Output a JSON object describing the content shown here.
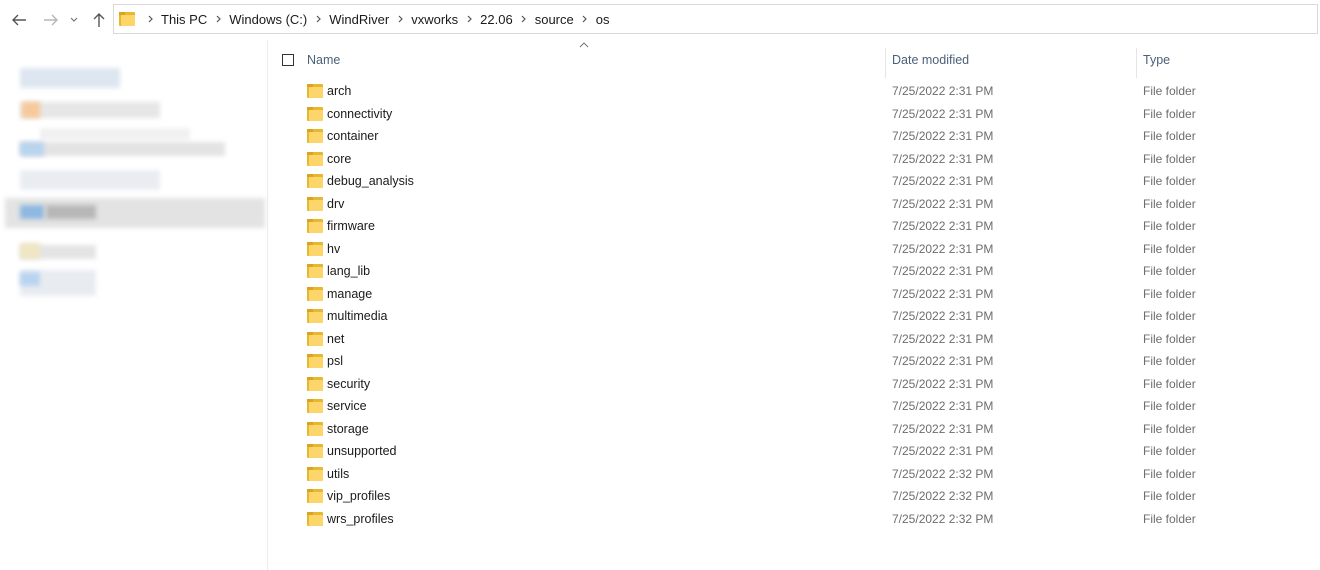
{
  "breadcrumb": [
    "This PC",
    "Windows (C:)",
    "WindRiver",
    "vxworks",
    "22.06",
    "source",
    "os"
  ],
  "columns": {
    "name": "Name",
    "date_modified": "Date modified",
    "type": "Type"
  },
  "icons": {
    "back": "arrow-left-icon",
    "forward": "arrow-right-icon",
    "recent": "chevron-down-icon",
    "up": "arrow-up-icon",
    "folder": "folder-icon"
  },
  "colors": {
    "folder": "#fdd66b",
    "header_text": "#4c607a"
  },
  "files": [
    {
      "name": "arch",
      "date": "7/25/2022 2:31 PM",
      "type": "File folder"
    },
    {
      "name": "connectivity",
      "date": "7/25/2022 2:31 PM",
      "type": "File folder"
    },
    {
      "name": "container",
      "date": "7/25/2022 2:31 PM",
      "type": "File folder"
    },
    {
      "name": "core",
      "date": "7/25/2022 2:31 PM",
      "type": "File folder"
    },
    {
      "name": "debug_analysis",
      "date": "7/25/2022 2:31 PM",
      "type": "File folder"
    },
    {
      "name": "drv",
      "date": "7/25/2022 2:31 PM",
      "type": "File folder"
    },
    {
      "name": "firmware",
      "date": "7/25/2022 2:31 PM",
      "type": "File folder"
    },
    {
      "name": "hv",
      "date": "7/25/2022 2:31 PM",
      "type": "File folder"
    },
    {
      "name": "lang_lib",
      "date": "7/25/2022 2:31 PM",
      "type": "File folder"
    },
    {
      "name": "manage",
      "date": "7/25/2022 2:31 PM",
      "type": "File folder"
    },
    {
      "name": "multimedia",
      "date": "7/25/2022 2:31 PM",
      "type": "File folder"
    },
    {
      "name": "net",
      "date": "7/25/2022 2:31 PM",
      "type": "File folder"
    },
    {
      "name": "psl",
      "date": "7/25/2022 2:31 PM",
      "type": "File folder"
    },
    {
      "name": "security",
      "date": "7/25/2022 2:31 PM",
      "type": "File folder"
    },
    {
      "name": "service",
      "date": "7/25/2022 2:31 PM",
      "type": "File folder"
    },
    {
      "name": "storage",
      "date": "7/25/2022 2:31 PM",
      "type": "File folder"
    },
    {
      "name": "unsupported",
      "date": "7/25/2022 2:31 PM",
      "type": "File folder"
    },
    {
      "name": "utils",
      "date": "7/25/2022 2:32 PM",
      "type": "File folder"
    },
    {
      "name": "vip_profiles",
      "date": "7/25/2022 2:32 PM",
      "type": "File folder"
    },
    {
      "name": "wrs_profiles",
      "date": "7/25/2022 2:32 PM",
      "type": "File folder"
    }
  ]
}
